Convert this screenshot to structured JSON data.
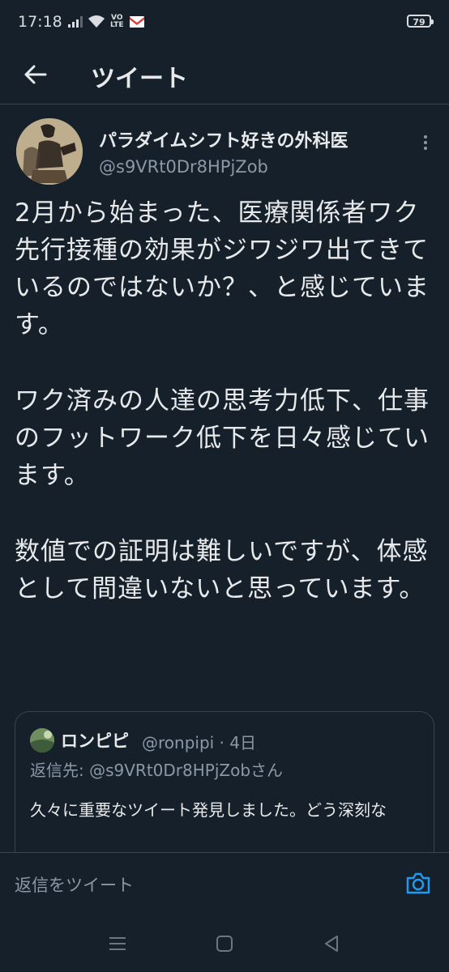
{
  "status_bar": {
    "time": "17:18",
    "volte_top": "VO",
    "volte_bottom": "LTE",
    "battery": "79"
  },
  "header": {
    "title": "ツイート",
    "back_icon": "arrow-left-icon"
  },
  "tweet": {
    "author_name": "パラダイムシフト好きの外科医",
    "author_handle": "@s9VRt0Dr8HPjZob",
    "paragraphs": [
      "2月から始まった、医療関係者ワク先行接種の効果がジワジワ出てきているのではないか？、と感じています。",
      "ワク済みの人達の思考力低下、仕事のフットワーク低下を日々感じています。",
      "数値での証明は難しいですが、体感として間違いないと思っています。"
    ]
  },
  "quote": {
    "name": "ロンピピ",
    "handle_time": "@ronpipi · 4日",
    "reply_to": "返信先: @s9VRt0Dr8HPjZobさん",
    "text": "久々に重要なツイート発見しました。どう深刻な"
  },
  "reply_bar": {
    "placeholder": "返信をツイート",
    "icon": "camera-icon"
  },
  "colors": {
    "background": "#15202b",
    "accent": "#1d9bf0",
    "secondary_text": "#8b98a5",
    "border": "#38444d"
  }
}
